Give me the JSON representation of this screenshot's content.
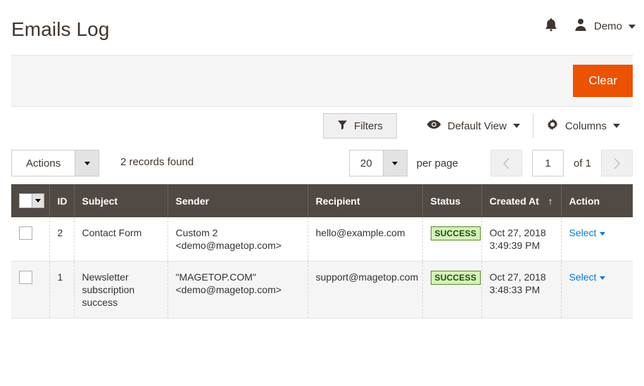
{
  "header": {
    "title": "Emails Log",
    "bell_icon": "bell-icon",
    "avatar_icon": "user-avatar-icon",
    "user_name": "Demo",
    "user_caret_icon": "chevron-down-icon"
  },
  "action_panel": {
    "clear_label": "Clear",
    "clear_color": "#eb5202"
  },
  "toolbar": {
    "filters_label": "Filters",
    "filters_icon": "funnel-icon",
    "view_label": "Default View",
    "view_icon": "eye-icon",
    "view_caret_icon": "chevron-down-icon",
    "columns_label": "Columns",
    "columns_icon": "gear-icon",
    "columns_caret_icon": "chevron-down-icon"
  },
  "grid_controls": {
    "actions_label": "Actions",
    "actions_caret_icon": "chevron-down-icon",
    "records_found": "2 records found",
    "per_page_value": "20",
    "per_page_caret_icon": "chevron-down-icon",
    "per_page_label": "per page",
    "prev_icon": "chevron-left-icon",
    "next_icon": "chevron-right-icon",
    "page_value": "1",
    "page_of": "of 1"
  },
  "grid": {
    "header_bg": "#514943",
    "columns": [
      {
        "key": "check",
        "label": ""
      },
      {
        "key": "id",
        "label": "ID"
      },
      {
        "key": "subject",
        "label": "Subject"
      },
      {
        "key": "sender",
        "label": "Sender"
      },
      {
        "key": "recipient",
        "label": "Recipient"
      },
      {
        "key": "status",
        "label": "Status"
      },
      {
        "key": "created_at",
        "label": "Created At"
      },
      {
        "key": "action",
        "label": "Action"
      }
    ],
    "sort_column": "Created At",
    "sort_arrow": "↑",
    "action_link_label": "Select",
    "action_caret_icon": "chevron-down-icon",
    "rows": [
      {
        "id": "2",
        "subject": "Contact Form",
        "sender_name": "Custom 2",
        "sender_email": "<demo@magetop.com>",
        "recipient": "hello@example.com",
        "status": "SUCCESS",
        "created_date": "Oct 27, 2018",
        "created_time": "3:49:39 PM",
        "action": "Select"
      },
      {
        "id": "1",
        "subject": "Newsletter subscription success",
        "sender_name": "\"MAGETOP.COM\"",
        "sender_email": "<demo@magetop.com>",
        "recipient": "support@magetop.com",
        "status": "SUCCESS",
        "created_date": "Oct 27, 2018",
        "created_time": "3:48:33 PM",
        "action": "Select"
      }
    ]
  },
  "colors": {
    "accent_orange": "#eb5202",
    "grid_header": "#514943",
    "link_blue": "#007bdb",
    "status_success_bg": "#d4f0bb",
    "status_success_text": "#1f5000"
  }
}
